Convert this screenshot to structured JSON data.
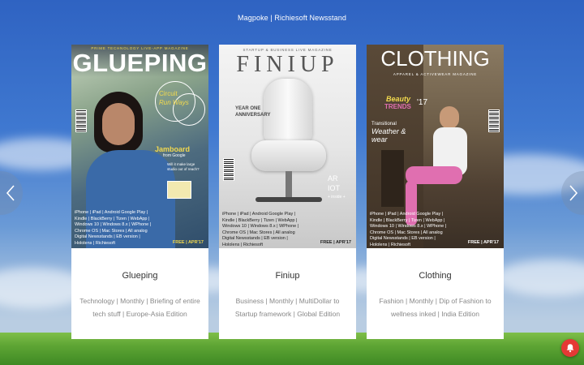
{
  "header": {
    "title": "Magpoke | Richiesoft Newsstand"
  },
  "nav": {
    "prev_icon": "chevron-left-icon",
    "next_icon": "chevron-right-icon"
  },
  "cards": [
    {
      "title": "Glueping",
      "description": "Technology | Monthly | Briefing of entire tech stuff | Europe-Asia Edition",
      "cover": {
        "tagline": "PRIME TECHNOLOGY LIVE-APP MAGAZINE",
        "masthead": "GLUEPING",
        "headline_1": "Circuit",
        "headline_2": "Run Ways",
        "headline_3": "Jamboard",
        "headline_4": "from Google",
        "headline_5": "Will it make large studio out of reach?",
        "platforms": "iPhone | iPad | Android Google Play | Kindle | BlackBerry | Tizen | WebApp | Windows 10 | Windows 8.x | WPhone | Chrome OS | Mac Stores | All analog Digital Newsstands | EB version | Hololens | Richiesoft",
        "badge": "FREE | APR'17"
      }
    },
    {
      "title": "Finiup",
      "description": "Business | Monthly | MultiDollar to Startup framework | Global Edition",
      "cover": {
        "tagline": "STARTUP & BUSINESS LIVE MAGAZINE",
        "masthead": "FINIUP",
        "headline_1": "YEAR ONE",
        "headline_2": "ANNIVERSARY",
        "headline_3": "AR",
        "headline_4": "IOT",
        "headline_5": "+ inside +",
        "platforms": "iPhone | iPad | Android Google Play | Kindle | BlackBerry | Tizen | WebApp | Windows 10 | Windows 8.x | WPhone | Chrome OS | Mac Stores | All analog Digital Newsstands | EB version | Hololens | Richiesoft",
        "badge": "FREE | APR'17"
      }
    },
    {
      "title": "Clothing",
      "description": "Fashion | Monthly | Dip of Fashion to wellness inked | India Edition",
      "cover": {
        "tagline": "APPAREL & ACTIVEWEAR MAGAZINE",
        "masthead": "CLOTHING",
        "headline_1": "Beauty",
        "headline_2": "TRENDS",
        "headline_3": "'17",
        "headline_4": "Transitional",
        "headline_5": "Weather & wear",
        "platforms": "iPhone | iPad | Android Google Play | Kindle | BlackBerry | Tizen | WebApp | Windows 10 | Windows 8.x | WPhone | Chrome OS | Mac Stores | All analog Digital Newsstands | EB version | Hololens | Richiesoft",
        "badge": "FREE | APR'17"
      }
    }
  ],
  "notification": {
    "icon": "bell-icon",
    "color": "#e53935"
  }
}
